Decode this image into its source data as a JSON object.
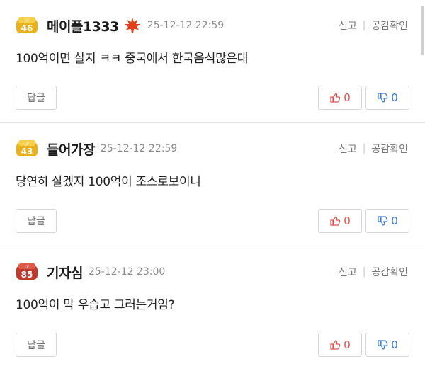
{
  "comments": [
    {
      "level": "46",
      "badge_color": "#e8b21e",
      "nickname": "메이플1333",
      "has_leaf": true,
      "date": "25-12-12 22:59",
      "report": "신고",
      "like_check": "공감확인",
      "text": "100억이면 살지 ㅋㅋ 중국에서 한국음식많은대",
      "reply": "답글",
      "up": "0",
      "down": "0"
    },
    {
      "level": "43",
      "badge_color": "#e8b21e",
      "nickname": "들어가장",
      "has_leaf": false,
      "date": "25-12-12 22:59",
      "report": "신고",
      "like_check": "공감확인",
      "text": "당연히 살겠지 100억이 조스로보이니",
      "reply": "답글",
      "up": "0",
      "down": "0"
    },
    {
      "level": "85",
      "badge_color": "#c0392b",
      "nickname": "기자심",
      "has_leaf": false,
      "date": "25-12-12 23:00",
      "report": "신고",
      "like_check": "공감확인",
      "text": "100억이 막 우습고 그러는거임?",
      "reply": "답글",
      "up": "0",
      "down": "0"
    }
  ],
  "colors": {
    "up": "#d9534f",
    "down": "#3b7dd8",
    "leaf": "#e0401a"
  }
}
